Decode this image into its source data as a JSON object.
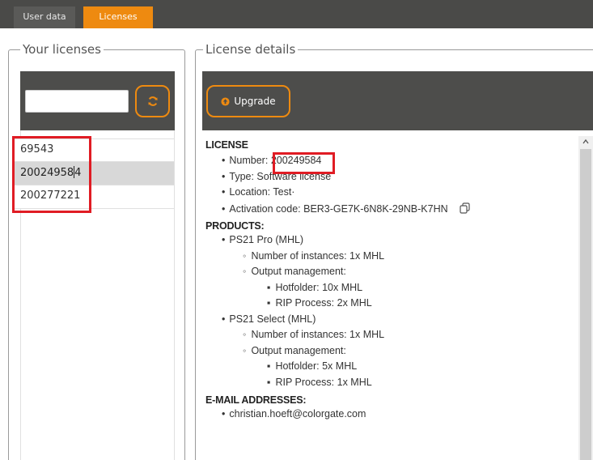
{
  "tabs": [
    {
      "label": "User data",
      "active": false
    },
    {
      "label": "Licenses",
      "active": true
    }
  ],
  "left_panel": {
    "title": "Your licenses",
    "search": {
      "value": "",
      "placeholder": ""
    },
    "refresh_icon": "refresh-icon",
    "licenses": [
      "69543",
      "20024958",
      "4",
      "200277221"
    ],
    "selected_index": 1
  },
  "right_panel": {
    "title": "License details",
    "upgrade_label": "Upgrade",
    "upgrade_icon": "arrow-up-circle-icon",
    "license_heading": "LICENSE",
    "number_label": "Number:",
    "number_value": "200249584",
    "type": "Type: Software license",
    "location": "Location: Test·",
    "activation": "Activation code: BER3-GE7K-6N8K-29NB-K7HN",
    "copy_icon": "copy-icon",
    "products_heading": "PRODUCTS:",
    "products": [
      {
        "name": "PS21 Pro (MHL)",
        "instances": "Number of instances: 1x MHL",
        "output": "Output management:",
        "hotfolder": "Hotfolder: 10x MHL",
        "rip": "RIP Process: 2x MHL"
      },
      {
        "name": "PS21 Select (MHL)",
        "instances": "Number of instances: 1x MHL",
        "output": "Output management:",
        "hotfolder": "Hotfolder: 5x MHL",
        "rip": "RIP Process: 1x MHL"
      }
    ],
    "email_heading": "E-MAIL ADDRESSES:",
    "emails": [
      "christian.hoeft@colorgate.com"
    ]
  },
  "colors": {
    "accent": "#ee8a10",
    "toolbar": "#4d4d4b",
    "highlight": "#e01c24"
  }
}
